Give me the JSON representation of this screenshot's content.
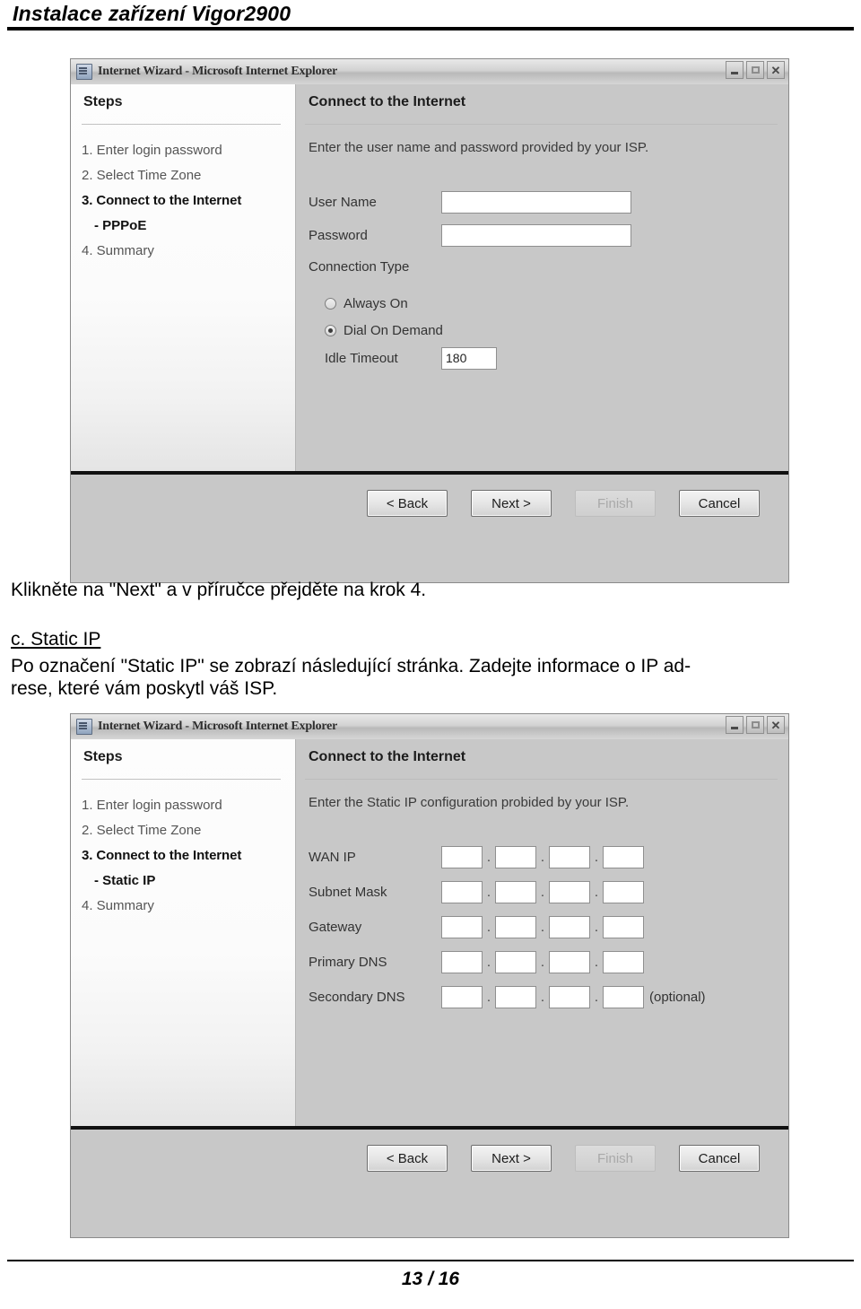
{
  "document": {
    "header_title": "Instalace zařízení Vigor2900",
    "page_number": "13 / 16"
  },
  "text_blocks": {
    "para1": "Klikněte na \"Next\" a v příručce přejděte na krok 4.",
    "heading_c": "c. Static IP",
    "para2_line1": "Po označení \"Static IP\" se zobrazí následující stránka. Zadejte informace o IP  ad-",
    "para2_line2": "rese, které vám poskytl váš ISP."
  },
  "wizard_pppoe": {
    "titlebar": {
      "title": "Internet Wizard - Microsoft Internet Explorer",
      "minimize": "_",
      "maximize": "□",
      "close": "✕"
    },
    "sidebar": {
      "title": "Steps",
      "steps": [
        {
          "label": "1. Enter login password",
          "state": "normal"
        },
        {
          "label": "2. Select Time Zone",
          "state": "normal"
        },
        {
          "label": "3. Connect to the Internet",
          "state": "current"
        },
        {
          "label": "- PPPoE",
          "state": "sub"
        },
        {
          "label": "4. Summary",
          "state": "normal"
        }
      ]
    },
    "content": {
      "title": "Connect to the Internet",
      "description": "Enter the user name and password provided by your ISP.",
      "fields": [
        {
          "label": "User Name",
          "value": ""
        },
        {
          "label": "Password",
          "value": ""
        }
      ],
      "connection_type_label": "Connection Type",
      "options": [
        {
          "label": "Always On",
          "selected": false
        },
        {
          "label": "Dial On Demand",
          "selected": true
        }
      ],
      "idle_timeout_label": "Idle Timeout",
      "idle_timeout_value": "180"
    },
    "buttons": [
      {
        "label": "< Back",
        "disabled": false
      },
      {
        "label": "Next >",
        "disabled": false
      },
      {
        "label": "Finish",
        "disabled": true
      },
      {
        "label": "Cancel",
        "disabled": false
      }
    ]
  },
  "wizard_static": {
    "titlebar": {
      "title": "Internet Wizard - Microsoft Internet Explorer",
      "minimize": "_",
      "maximize": "□",
      "close": "✕"
    },
    "sidebar": {
      "title": "Steps",
      "steps": [
        {
          "label": "1. Enter login password",
          "state": "normal"
        },
        {
          "label": "2. Select Time Zone",
          "state": "normal"
        },
        {
          "label": "3. Connect to the Internet",
          "state": "current"
        },
        {
          "label": "- Static IP",
          "state": "sub"
        },
        {
          "label": "4. Summary",
          "state": "normal"
        }
      ]
    },
    "content": {
      "title": "Connect to the Internet",
      "description": "Enter the Static IP configuration probided by your ISP.",
      "separator": ".",
      "optional_note": "(optional)",
      "rows": [
        {
          "label": "WAN IP",
          "octets": [
            "",
            "",
            "",
            ""
          ],
          "optional": false
        },
        {
          "label": "Subnet Mask",
          "octets": [
            "",
            "",
            "",
            ""
          ],
          "optional": false
        },
        {
          "label": "Gateway",
          "octets": [
            "",
            "",
            "",
            ""
          ],
          "optional": false
        },
        {
          "label": "Primary DNS",
          "octets": [
            "",
            "",
            "",
            ""
          ],
          "optional": false
        },
        {
          "label": "Secondary DNS",
          "octets": [
            "",
            "",
            "",
            ""
          ],
          "optional": true
        }
      ]
    },
    "buttons": [
      {
        "label": "< Back",
        "disabled": false
      },
      {
        "label": "Next >",
        "disabled": false
      },
      {
        "label": "Finish",
        "disabled": true
      },
      {
        "label": "Cancel",
        "disabled": false
      }
    ]
  }
}
